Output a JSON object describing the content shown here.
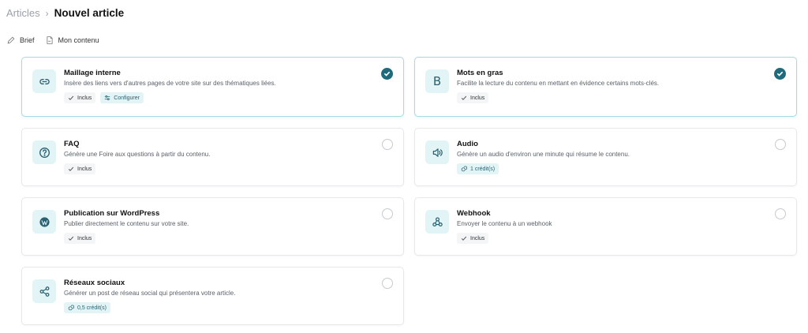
{
  "breadcrumb": {
    "parent": "Articles",
    "separator": "›",
    "current": "Nouvel article"
  },
  "subnav": {
    "brief": "Brief",
    "content": "Mon contenu"
  },
  "options": {
    "maillage": {
      "title": "Maillage interne",
      "desc": "Insère des liens vers d'autres pages de votre site sur des thématiques liées.",
      "badge": "Inclus",
      "configure": "Configurer",
      "selected": true,
      "icon": "link-icon"
    },
    "gras": {
      "title": "Mots en gras",
      "desc": "Facilite la lecture du contenu en mettant en évidence certains mots-clés.",
      "badge": "Inclus",
      "selected": true,
      "icon": "bold-icon",
      "glyph": "B"
    },
    "faq": {
      "title": "FAQ",
      "desc": "Génère une Foire aux questions à partir du contenu.",
      "badge": "Inclus",
      "selected": false,
      "icon": "question-icon"
    },
    "audio": {
      "title": "Audio",
      "desc": "Génère un audio d'environ une minute qui résume le contenu.",
      "badge": "1 crédit(s)",
      "selected": false,
      "icon": "speaker-icon"
    },
    "wordpress": {
      "title": "Publication sur WordPress",
      "desc": "Publier directement le contenu sur votre site.",
      "badge": "Inclus",
      "selected": false,
      "icon": "wordpress-icon"
    },
    "webhook": {
      "title": "Webhook",
      "desc": "Envoyer le contenu à un webhook",
      "badge": "Inclus",
      "selected": false,
      "icon": "webhook-icon"
    },
    "reseaux": {
      "title": "Réseaux sociaux",
      "desc": "Générer un post de réseau social qui présentera votre article.",
      "badge": "0,5 crédit(s)",
      "selected": false,
      "icon": "share-icon"
    }
  },
  "colors": {
    "accent": "#1f6b7b",
    "icon_bg": "#e2f4f6",
    "selected_border": "#a6dbe1"
  }
}
